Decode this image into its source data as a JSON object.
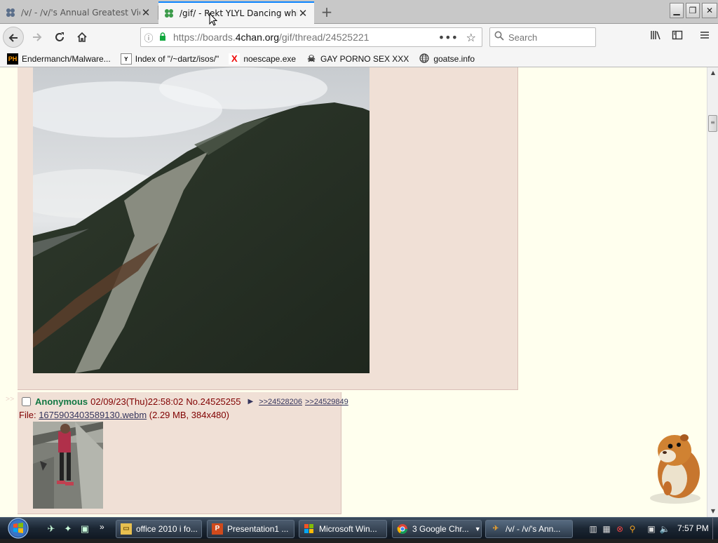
{
  "browser": {
    "tabs": [
      {
        "title": "/v/ - /v/'s Annual Greatest Video",
        "active": false
      },
      {
        "title": "/gif/ - Rekt YLYL Dancing while",
        "active": true
      }
    ],
    "url": {
      "prefix": "https://boards.",
      "domain": "4chan.org",
      "path": "/gif/thread/24525221"
    },
    "search_placeholder": "Search"
  },
  "bookmarks": [
    {
      "label": "Endermanch/Malware...",
      "icon": "PH"
    },
    {
      "label": "Index of \"/~dartz/isos/\"",
      "icon": "Y"
    },
    {
      "label": "noescape.exe",
      "icon": "X"
    },
    {
      "label": "GAY PORNO SEX XXX",
      "icon": "skull-icon"
    },
    {
      "label": "goatse.info",
      "icon": "globe-icon"
    }
  ],
  "post": {
    "side_arrows": ">>",
    "name": "Anonymous",
    "datetime": "02/09/23(Thu)22:58:02",
    "number": "No.24525255",
    "backlinks": [
      ">>24528206",
      ">>24529849"
    ],
    "file_label": "File:",
    "file_name": "1675903403589130.webm",
    "file_meta": "(2.29 MB, 384x480)"
  },
  "taskbar": {
    "buttons": [
      {
        "label": "office 2010 i fo...",
        "icon": "folder-icon"
      },
      {
        "label": "Presentation1 ...",
        "icon": "P"
      },
      {
        "label": "Microsoft Win...",
        "icon": "word-icon"
      },
      {
        "label": "3 Google Chr...",
        "icon": "chrome-icon"
      },
      {
        "label": "/v/ - /v/'s Ann...",
        "icon": "firefox-icon"
      }
    ],
    "clock": "7:57 PM"
  },
  "colors": {
    "page_bg": "#ffffee",
    "post_bg": "#f0e0d6",
    "name_green": "#117743",
    "text_maroon": "#800000",
    "link_blue": "#34345c",
    "accent_tab": "#0a84ff"
  }
}
